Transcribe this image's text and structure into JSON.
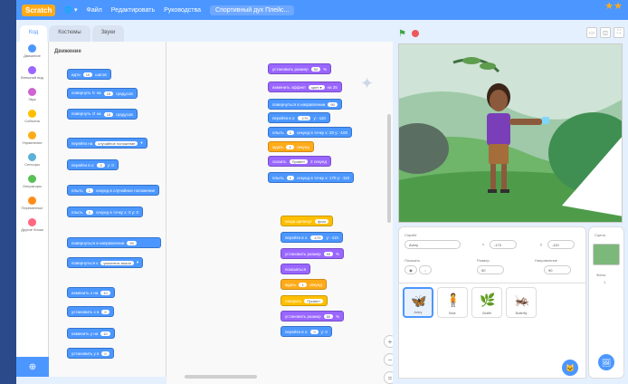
{
  "menubar": {
    "logo": "Scratch",
    "globe": "🌐 ▾",
    "file": "Файл",
    "edit": "Редактировать",
    "tutorials": "Руководства",
    "project_title": "Спортивный дух Плейс...",
    "top_right_icons": "★★"
  },
  "tabs": {
    "code": "Код",
    "costumes": "Костюмы",
    "sounds": "Звуки"
  },
  "categories": [
    {
      "label": "Движение",
      "color": "#4c97ff"
    },
    {
      "label": "Внешний вид",
      "color": "#9966ff"
    },
    {
      "label": "Звук",
      "color": "#cf63cf"
    },
    {
      "label": "События",
      "color": "#ffbf00"
    },
    {
      "label": "Управление",
      "color": "#ffab19"
    },
    {
      "label": "Сенсоры",
      "color": "#5cb1d6"
    },
    {
      "label": "Операторы",
      "color": "#59c059"
    },
    {
      "label": "Переменные",
      "color": "#ff8c1a"
    },
    {
      "label": "Другие блоки",
      "color": "#ff6680"
    }
  ],
  "palette": {
    "title": "Движение",
    "blocks": [
      {
        "text": "идти",
        "slot": "10",
        "suffix": "шагов",
        "cls": "motion"
      },
      {
        "text": "повернуть ↻ на",
        "slot": "15",
        "suffix": "градусов",
        "cls": "motion"
      },
      {
        "text": "повернуть ↺ на",
        "slot": "15",
        "suffix": "градусов",
        "cls": "motion"
      },
      {
        "text": "перейти на",
        "slot": "случайное положение",
        "suffix": "▾",
        "cls": "motion"
      },
      {
        "text": "перейти в x:",
        "slot": "0",
        "suffix": "y: 0",
        "cls": "motion"
      },
      {
        "text": "плыть",
        "slot": "1",
        "suffix": "секунд в случайное положение",
        "cls": "motion"
      },
      {
        "text": "плыть",
        "slot": "1",
        "suffix": "секунд в точку x: 0 y: 0",
        "cls": "motion"
      },
      {
        "text": "повернуться в направлении",
        "slot": "90",
        "suffix": "",
        "cls": "motion"
      },
      {
        "text": "повернуться к",
        "slot": "указатель мыши",
        "suffix": "▾",
        "cls": "motion"
      },
      {
        "text": "изменить x на",
        "slot": "10",
        "suffix": "",
        "cls": "motion"
      },
      {
        "text": "установить x в",
        "slot": "0",
        "suffix": "",
        "cls": "motion"
      },
      {
        "text": "изменить y на",
        "slot": "10",
        "suffix": "",
        "cls": "motion"
      },
      {
        "text": "установить y в",
        "slot": "0",
        "suffix": "",
        "cls": "motion"
      }
    ]
  },
  "script1": [
    {
      "text": "установить размер",
      "slot": "50",
      "suffix": "%",
      "cls": "looks"
    },
    {
      "text": "изменить эффект",
      "slot": "цвет ▾",
      "suffix": "на 25",
      "cls": "looks"
    },
    {
      "text": "повернуться в направлении",
      "slot": "90",
      "suffix": "",
      "cls": "motion"
    },
    {
      "text": "перейти в x:",
      "slot": "-170",
      "suffix": "y: -110",
      "cls": "motion"
    },
    {
      "text": "плыть",
      "slot": "1",
      "suffix": "секунд в точку x: 20 y: -100",
      "cls": "motion"
    },
    {
      "text": "ждать",
      "slot": "1",
      "suffix": "секунд",
      "cls": "control"
    },
    {
      "text": "сказать",
      "slot": "Привет!",
      "suffix": "2 секунд",
      "cls": "looks"
    },
    {
      "text": "плыть",
      "slot": "1",
      "suffix": "секунд в точку x: 170 y: -110",
      "cls": "motion"
    }
  ],
  "script2": [
    {
      "text": "когда щёлкнут",
      "slot": "флаг",
      "suffix": "",
      "cls": "events"
    },
    {
      "text": "перейти в x:",
      "slot": "-170",
      "suffix": "y: -110",
      "cls": "motion"
    },
    {
      "text": "установить размер",
      "slot": "50",
      "suffix": "%",
      "cls": "looks"
    },
    {
      "text": "показаться",
      "slot": "",
      "suffix": "",
      "cls": "looks"
    },
    {
      "text": "ждать",
      "slot": "1",
      "suffix": "секунд",
      "cls": "control"
    },
    {
      "text": "говорить",
      "slot": "Привет!",
      "suffix": "",
      "cls": "events"
    },
    {
      "text": "установить размер",
      "slot": "80",
      "suffix": "%",
      "cls": "looks"
    },
    {
      "text": "перейти в x:",
      "slot": "0",
      "suffix": "y: 0",
      "cls": "motion"
    }
  ],
  "script3": {
    "text": "когда я получу",
    "slot": "сообщение",
    "suffix": "",
    "cls": "events"
  },
  "zoom": {
    "in": "+",
    "out": "−",
    "reset": "="
  },
  "stage_header": {
    "flag": "⚑",
    "view_small": "▭",
    "view_normal": "◫",
    "fullscreen": "⛶"
  },
  "sprite_info": {
    "sprite_label": "Спрайт",
    "sprite_name": "Avery",
    "x_label": "x",
    "x_value": "-170",
    "y_label": "y",
    "y_value": "-110",
    "show_label": "Показать",
    "size_label": "Размер",
    "size_value": "50",
    "direction_label": "Направление",
    "direction_value": "90"
  },
  "sprites": [
    {
      "name": "Avery",
      "pic": "🦋"
    },
    {
      "name": "Bear",
      "pic": "🧍"
    },
    {
      "name": "Giraffe",
      "pic": "🌿"
    },
    {
      "name": "Butterfly",
      "pic": "🦗"
    }
  ],
  "backdrop_panel": {
    "title": "Сцена",
    "count_label": "Фоны",
    "count": "1"
  },
  "fab_sprite": "🐱",
  "fab_backdrop": "🖼",
  "bottom_btn": "⊕"
}
